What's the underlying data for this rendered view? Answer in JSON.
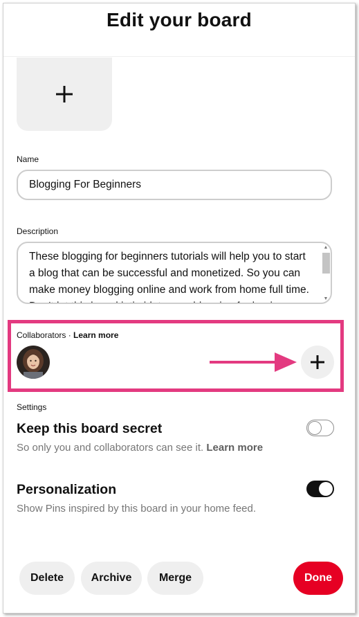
{
  "header": {
    "title": "Edit your board"
  },
  "name": {
    "label": "Name",
    "value": "Blogging For Beginners"
  },
  "description": {
    "label": "Description",
    "value": "These blogging for beginners tutorials will help you to start a blog that can be successful and monetized. So you can make money blogging online and work from home full time. Don't let this board intimidate you, blogging for beginners can be done."
  },
  "collaborators": {
    "label": "Collaborators · ",
    "learn_more": "Learn more"
  },
  "settings": {
    "label": "Settings",
    "secret": {
      "title": "Keep this board secret",
      "desc": "So only you and collaborators can see it. ",
      "learn_more": "Learn more",
      "enabled": false
    },
    "personalization": {
      "title": "Personalization",
      "desc": "Show Pins inspired by this board in your home feed.",
      "enabled": true
    }
  },
  "actions": {
    "delete": "Delete",
    "archive": "Archive",
    "merge": "Merge",
    "done": "Done"
  },
  "colors": {
    "highlight": "#e33a80",
    "done_button": "#e60023",
    "toggle_on": "#111111"
  },
  "icons": {
    "cover_add": "plus-icon",
    "add_collaborator": "plus-icon",
    "annotation": "arrow-right-icon"
  }
}
